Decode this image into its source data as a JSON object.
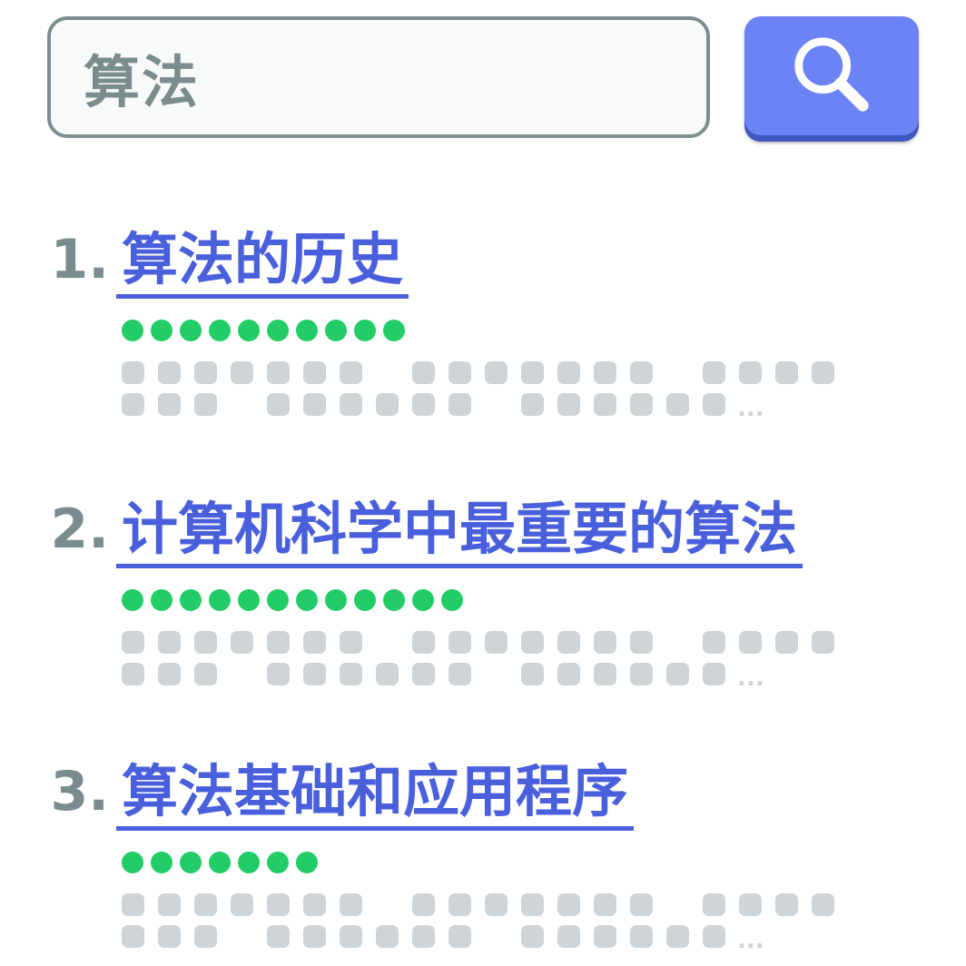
{
  "search": {
    "query": "算法"
  },
  "icons": {
    "search_button": "magnifier-icon",
    "title_color": "#4a5fdc",
    "rating_color": "#22cc66",
    "placeholder_text_color": "#cfd4d8",
    "button_color": "#6b83f5"
  },
  "results": [
    {
      "number": "1.",
      "title": "算法的历史",
      "rating_dots": 10,
      "snippet_ellipsis": "..."
    },
    {
      "number": "2.",
      "title": "计算机科学中最重要的算法",
      "rating_dots": 12,
      "snippet_ellipsis": "..."
    },
    {
      "number": "3.",
      "title": "算法基础和应用程序",
      "rating_dots": 7,
      "snippet_ellipsis": "..."
    }
  ]
}
